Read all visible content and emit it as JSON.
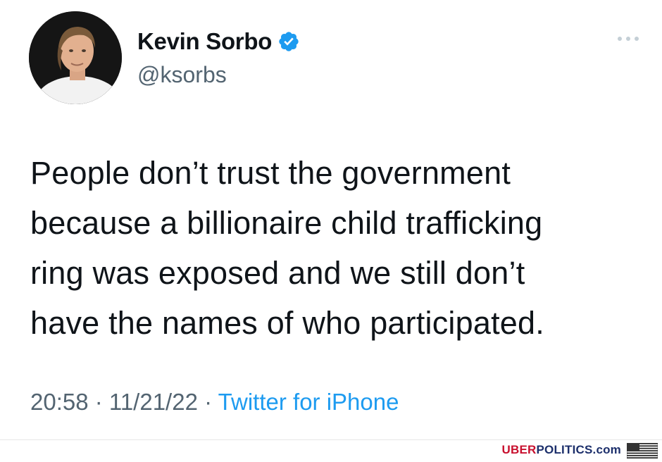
{
  "tweet": {
    "display_name": "Kevin Sorbo",
    "handle": "@ksorbs",
    "verified_icon": "verified-badge-icon",
    "more_icon": "more-options-icon",
    "body_lines": [
      "People don’t trust the government",
      "because a billionaire child trafficking",
      "ring was exposed and we still don’t",
      "have the names of who participated."
    ],
    "time": "20:58",
    "separator": " · ",
    "date": "11/21/22",
    "source": "Twitter for iPhone"
  },
  "watermark": {
    "brand_part1": "UBER",
    "brand_part2": "POLITICS",
    "brand_part3": ".com",
    "flag_icon": "us-flag-icon"
  },
  "colors": {
    "text": "#0f1419",
    "secondary": "#536471",
    "link": "#1d9bf0",
    "verified": "#1d9bf0",
    "brand_red": "#c8102e",
    "brand_blue": "#1c2f6b"
  }
}
